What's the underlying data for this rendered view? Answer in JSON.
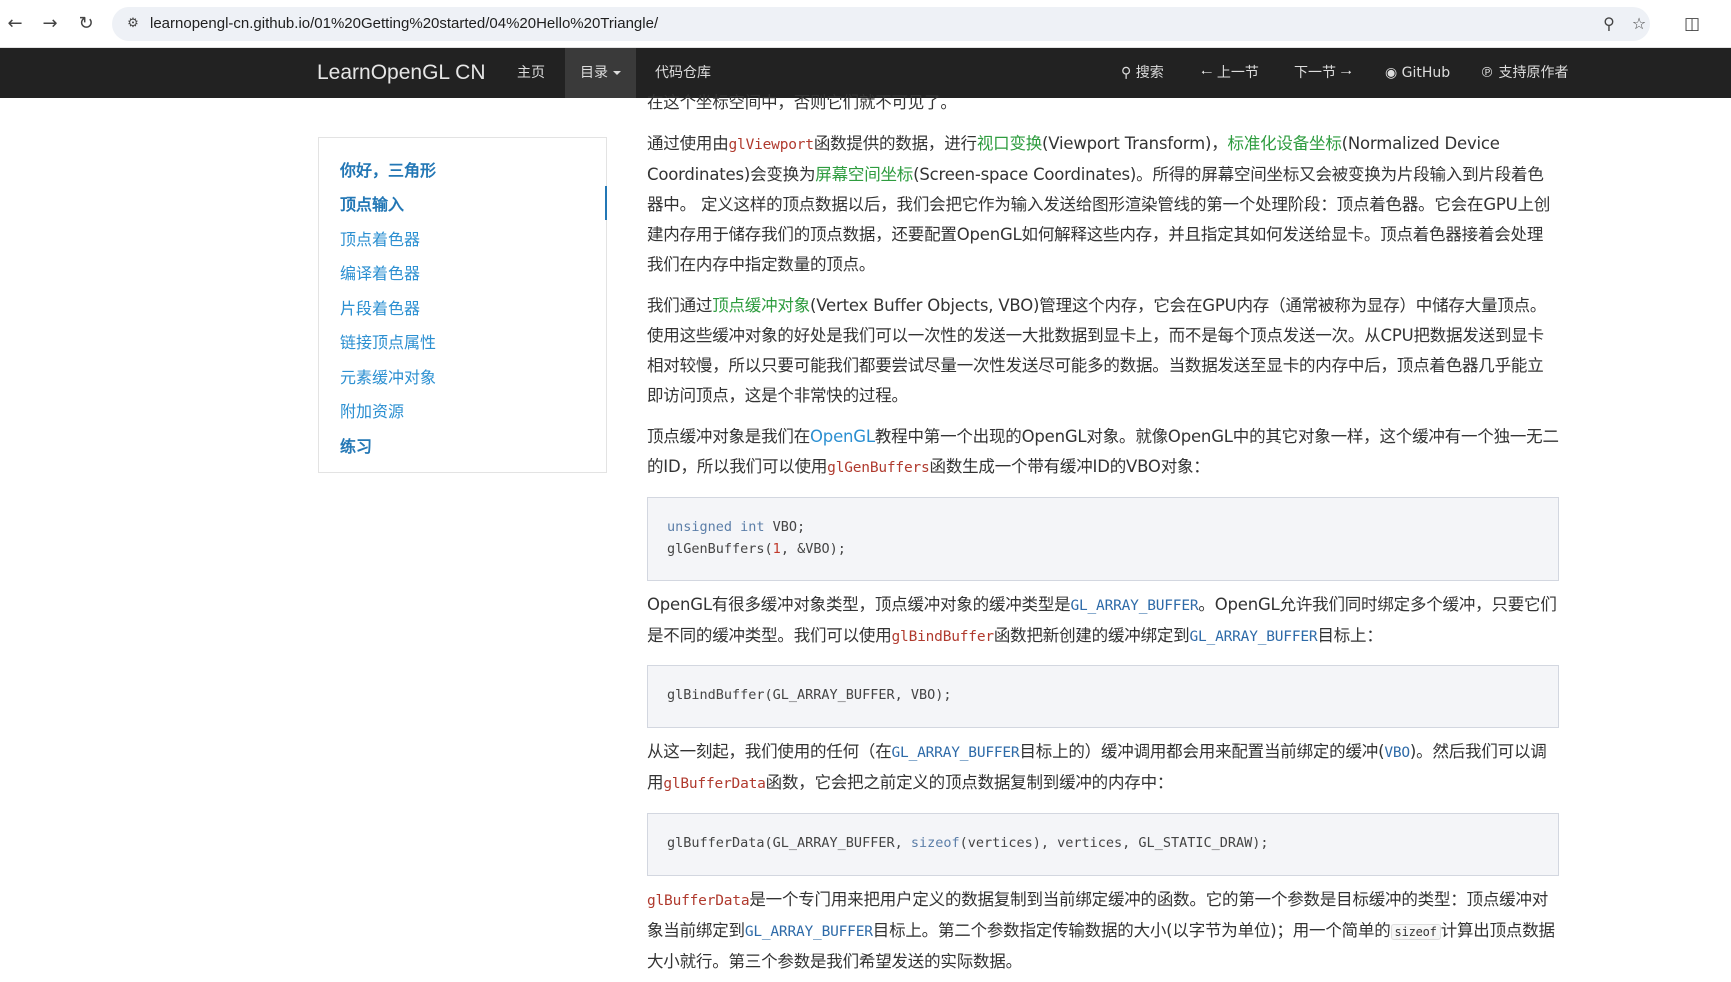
{
  "browser": {
    "url": "learnopengl-cn.github.io/01%20Getting%20started/04%20Hello%20Triangle/",
    "icons": [
      "back-icon",
      "forward-icon",
      "reload-icon",
      "site-info-icon",
      "zoom-icon",
      "star-icon",
      "extensions-icon"
    ]
  },
  "navbar": {
    "brand": "LearnOpenGL CN",
    "home": "主页",
    "toc": "目录",
    "repo": "代码仓库",
    "search": "搜索",
    "prev": "上一节",
    "next": "下一节",
    "github": "GitHub",
    "support": "支持原作者"
  },
  "sidebar": {
    "items": [
      {
        "label": "你好，三角形",
        "bold": true
      },
      {
        "label": "顶点输入",
        "bold": true,
        "active": true
      },
      {
        "label": "顶点着色器"
      },
      {
        "label": "编译着色器"
      },
      {
        "label": "片段着色器"
      },
      {
        "label": "链接顶点属性"
      },
      {
        "label": "元素缓冲对象"
      },
      {
        "label": "附加资源"
      },
      {
        "label": "练习",
        "bold": true
      }
    ]
  },
  "content": {
    "top_cut": "在这个坐标空间中，否则它们就不可见了。",
    "p1": {
      "a": "通过使用由",
      "code1": "glViewport",
      "b": "函数提供的数据，进行",
      "term1": "视口变换",
      "c": "(Viewport Transform)，",
      "term2": "标准化设备坐标",
      "d": "(Normalized Device Coordinates)会变换为",
      "term3": "屏幕空间坐标",
      "e": "(Screen-space Coordinates)。所得的屏幕空间坐标又会被变换为片段输入到片段着色器中。 定义这样的顶点数据以后，我们会把它作为输入发送给图形渲染管线的第一个处理阶段：顶点着色器。它会在GPU上创建内存用于储存我们的顶点数据，还要配置OpenGL如何解释这些内存，并且指定其如何发送给显卡。顶点着色器接着会处理我们在内存中指定数量的顶点。"
    },
    "p2": {
      "a": "我们通过",
      "term1": "顶点缓冲对象",
      "b": "(Vertex Buffer Objects, VBO)管理这个内存，它会在GPU内存（通常被称为显存）中储存大量顶点。使用这些缓冲对象的好处是我们可以一次性的发送一大批数据到显卡上，而不是每个顶点发送一次。从CPU把数据发送到显卡相对较慢，所以只要可能我们都要尝试尽量一次性发送尽可能多的数据。当数据发送至显卡的内存中后，顶点着色器几乎能立即访问顶点，这是个非常快的过程。"
    },
    "p3": {
      "a": "顶点缓冲对象是我们在",
      "link1": "OpenGL",
      "b": "教程中第一个出现的OpenGL对象。就像OpenGL中的其它对象一样，这个缓冲有一个独一无二的ID，所以我们可以使用",
      "code1": "glGenBuffers",
      "c": "函数生成一个带有缓冲ID的VBO对象："
    },
    "code1": {
      "l1_kw": "unsigned int",
      "l1_rest": " VBO;",
      "l2_a": "glGenBuffers(",
      "l2_num": "1",
      "l2_b": ", &VBO);"
    },
    "p4": {
      "a": "OpenGL有很多缓冲对象类型，顶点缓冲对象的缓冲类型是",
      "code1": "GL_ARRAY_BUFFER",
      "b": "。OpenGL允许我们同时绑定多个缓冲，只要它们是不同的缓冲类型。我们可以使用",
      "code2": "glBindBuffer",
      "c": "函数把新创建的缓冲绑定到",
      "code3": "GL_ARRAY_BUFFER",
      "d": "目标上："
    },
    "code2": {
      "line": "glBindBuffer(GL_ARRAY_BUFFER, VBO);"
    },
    "p5": {
      "a": "从这一刻起，我们使用的任何（在",
      "code1": "GL_ARRAY_BUFFER",
      "b": "目标上的）缓冲调用都会用来配置当前绑定的缓冲(",
      "code2": "VBO",
      "c": ")。然后我们可以调用",
      "code3": "glBufferData",
      "d": "函数，它会把之前定义的顶点数据复制到缓冲的内存中："
    },
    "code3": {
      "a": "glBufferData(GL_ARRAY_BUFFER, ",
      "kw": "sizeof",
      "b": "(vertices), vertices, GL_STATIC_DRAW);"
    },
    "p6": {
      "code1": "glBufferData",
      "a": "是一个专门用来把用户定义的数据复制到当前绑定缓冲的函数。它的第一个参数是目标缓冲的类型：顶点缓冲对象当前绑定到",
      "code2": "GL_ARRAY_BUFFER",
      "b": "目标上。第二个参数指定传输数据的大小(以字节为单位)；用一个简单的",
      "code3": "sizeof",
      "c": "计算出顶点数据大小就行。第三个参数是我们希望发送的实际数据。"
    }
  }
}
